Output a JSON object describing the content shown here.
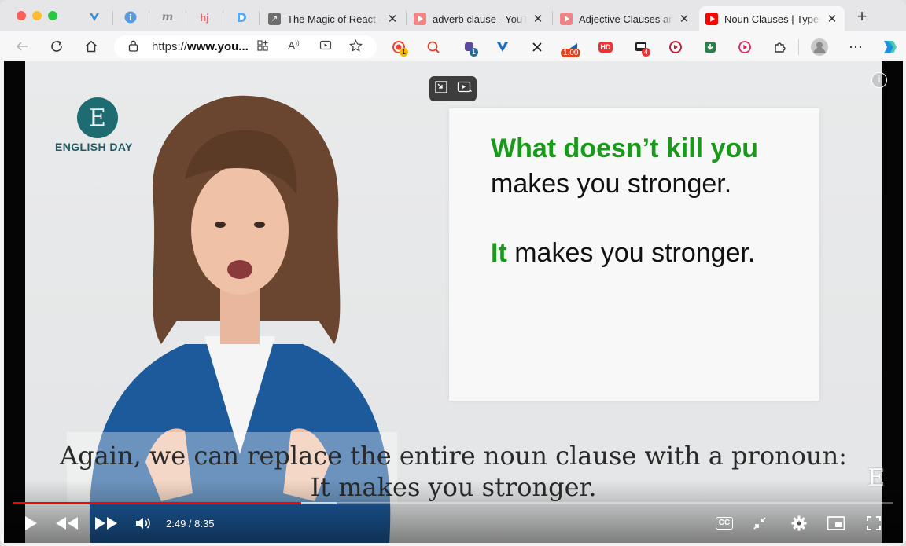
{
  "browser": {
    "tabs": [
      {
        "title": "The Magic of React -",
        "favicon": "arrow-icon",
        "active": false
      },
      {
        "title": "adverb clause - YouT",
        "favicon": "youtube-icon",
        "active": false
      },
      {
        "title": "Adjective Clauses an",
        "favicon": "youtube-icon",
        "active": false
      },
      {
        "title": "Noun Clauses | Types",
        "favicon": "youtube-icon",
        "active": true
      }
    ],
    "pinned_tabs": [
      "vivaldi-icon",
      "info-icon",
      "m-icon",
      "hj-icon",
      "d-icon"
    ],
    "pinned_labels": {
      "m": "m",
      "hj": "hj"
    },
    "url": {
      "scheme": "https://",
      "host": "www.you..."
    },
    "extensions": [
      {
        "name": "record-icon",
        "badge": "1"
      },
      {
        "name": "search-zoom-icon",
        "badge": ""
      },
      {
        "name": "puzzle-badge-icon",
        "badge": "1"
      },
      {
        "name": "vpn-icon",
        "badge": ""
      },
      {
        "name": "arrows-icon",
        "badge": ""
      },
      {
        "name": "speed-icon",
        "badge": "1.00"
      },
      {
        "name": "hd-icon",
        "badge": ""
      },
      {
        "name": "screen-icon",
        "badge": "4"
      },
      {
        "name": "camera-icon",
        "badge": ""
      },
      {
        "name": "download-icon",
        "badge": ""
      },
      {
        "name": "play-circle-icon",
        "badge": ""
      }
    ],
    "extension_labels": {
      "hd": "HD"
    },
    "colors": {
      "accent": "#ff0000",
      "tab_bg": "#e6e6e8"
    }
  },
  "video": {
    "channel_logo_text": "ENGLISH DAY",
    "logo_letter": "E",
    "slide": {
      "line1": "What doesn’t kill you",
      "line2": "makes you stronger.",
      "line3_green": "It",
      "line3_rest": " makes you stronger."
    },
    "caption": {
      "line1": "Again, we can replace the entire noun clause with a pronoun:",
      "line2": "It makes you stronger."
    },
    "watermark": "E",
    "info_label": "i"
  },
  "player": {
    "current_time": "2:49",
    "duration": "8:35",
    "time_display": "2:49 / 8:35",
    "played_fraction": 0.328,
    "buffered_fraction": 0.368,
    "cc_label": "CC"
  }
}
